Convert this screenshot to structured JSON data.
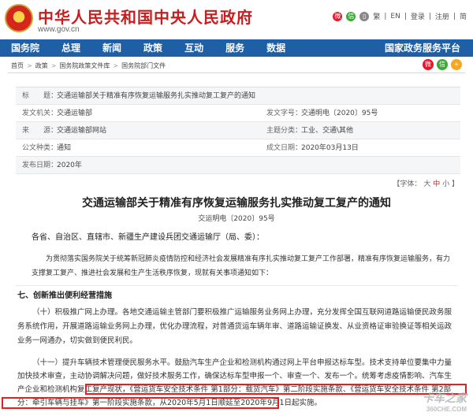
{
  "header": {
    "site_title": "中华人民共和国中央人民政府",
    "site_domain": "www.gov.cn",
    "links": [
      "繁",
      "EN",
      "登录",
      "注册",
      "简"
    ]
  },
  "nav": {
    "items": [
      "国务院",
      "总理",
      "新闻",
      "政策",
      "互动",
      "服务",
      "数据",
      "国家政务服务平台"
    ]
  },
  "breadcrumb": [
    "首页",
    "政策",
    "国务院政策文件库",
    "国务院部门文件"
  ],
  "meta": {
    "rows": [
      {
        "k": "标　　题：",
        "v": "交通运输部关于精准有序恢复运输服务扎实推动复工复产的通知"
      },
      {
        "k": "发文机关：",
        "v": "交通运输部",
        "k2": "发文字号：",
        "v2": "交通明电〔2020〕95号"
      },
      {
        "k": "来　　源：",
        "v": "交通运输部网站",
        "k2": "主题分类：",
        "v2": "工业、交通\\其他"
      },
      {
        "k": "公文种类：",
        "v": "通知",
        "k2": "成文日期：",
        "v2": "2020年03月13日"
      },
      {
        "k": "发布日期：",
        "v": "2020年"
      }
    ]
  },
  "fontsize": {
    "label": "【字体：",
    "large": "大",
    "mid": "中",
    "small": "小",
    "end": "】"
  },
  "article": {
    "title": "交通运输部关于精准有序恢复运输服务扎实推动复工复产的通知",
    "number": "交运明电〔2020〕95号",
    "recipient": "各省、自治区、直辖市、新疆生产建设兵团交通运输厅（局、委）：",
    "intro": "为贯彻落实国务院关于统筹新冠肺炎疫情防控和经济社会发展精准有序扎实推动复工复产工作部署，精准有序恢复运输服务，有力支撑复工复产、推进社会发展和生产生活秩序恢复，现就有关事项通知如下：",
    "section": "七、创新推出便利经营措施",
    "p1": "（十）积极推广网上办理。各地交通运输主管部门要积极推广运输服务业务网上办理，充分发挥全国互联网道路运输便民政务服务系统作用，开展道路运输业务网上办理，优化办理流程，对普通货运车辆年审、道路运输证换发、从业资格证审验换证等相关运政业务一网通办，切实做到便民利民。",
    "p2": "（十一）提升车辆技术管理便民服务水平。鼓励汽车生产企业和检测机构通过网上平台申报达标车型。技术支持单位要集中力量加快技术审查，主动协调解决问题，做好技术服务工作，确保达标车型申报一个、审查一个、发布一个。统筹考虑疫情影响、汽车生产企业和检测机构复工复产现状，《营运货车安全技术条件 第1部分：载货汽车》第二阶段实施条款、《营运货车安全技术条件 第2部分：牵引车辆与挂车》第一阶段实施条款，从2020年5月1日顺延至2020年9月1日起实施。"
  },
  "watermark": {
    "main": "卡车之家",
    "sub": "360CHE.COM"
  }
}
